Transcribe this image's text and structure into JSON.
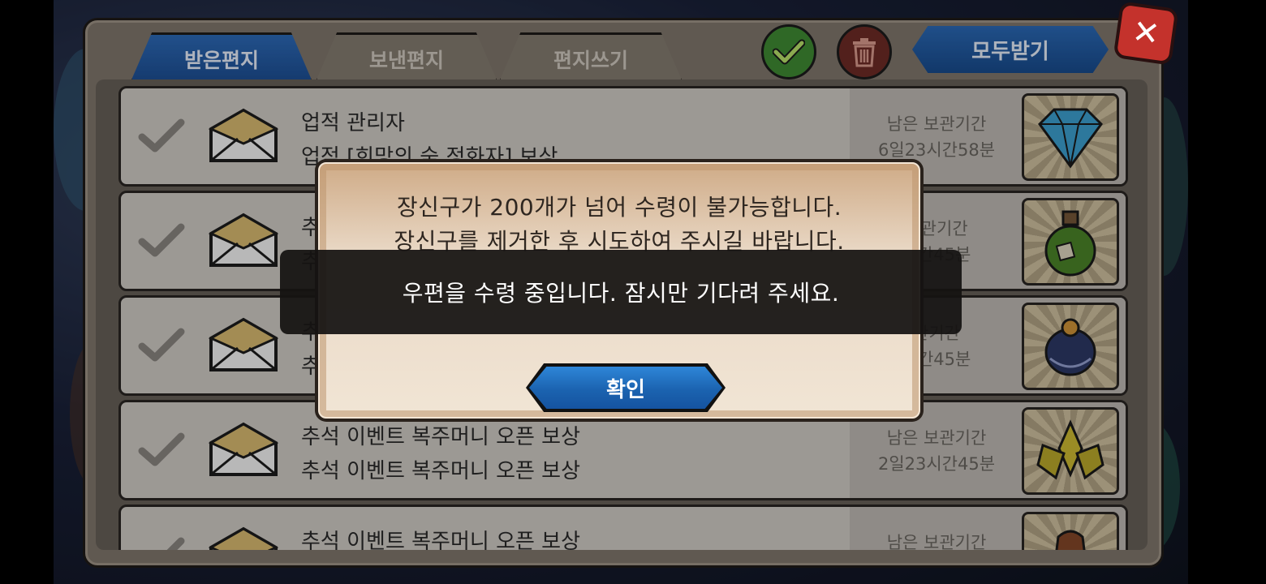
{
  "header": {
    "tabs": [
      {
        "label": "받은편지",
        "active": true
      },
      {
        "label": "보낸편지",
        "active": false
      },
      {
        "label": "편지쓰기",
        "active": false
      }
    ],
    "select_all_icon": "check-icon",
    "delete_icon": "trash-icon",
    "receive_all_label": "모두받기",
    "close_icon": "close-icon"
  },
  "mail_list": {
    "items": [
      {
        "sender": "업적 관리자",
        "subject": "업적 [희망의 숲 정화자] 보상",
        "expire_label": "남은 보관기간",
        "expire_time": "6일23시간58분",
        "reward_icon": "diamond-icon"
      },
      {
        "sender": "추",
        "subject": "추",
        "expire_label": "보관기간",
        "expire_time": "시간45분",
        "reward_icon": "potion-icon"
      },
      {
        "sender": "추",
        "subject": "추",
        "expire_label": "관기간",
        "expire_time": "시간45분",
        "reward_icon": "pet-egg-icon"
      },
      {
        "sender": "추석 이벤트 복주머니 오픈 보상",
        "subject": "추석 이벤트 복주머니 오픈 보상",
        "expire_label": "남은 보관기간",
        "expire_time": "2일23시간45분",
        "reward_icon": "crystal-icon"
      },
      {
        "sender": "추석 이벤트 복주머니 오픈 보상",
        "subject": "",
        "expire_label": "남은 보관기간",
        "expire_time": "",
        "reward_icon": "pouch-icon"
      }
    ]
  },
  "dialog": {
    "message_line1": "장신구가 200개가 넘어 수령이 불가능합니다.",
    "message_line2": "장신구를 제거한 후 시도하여 주시길 바랍니다.",
    "confirm_label": "확인"
  },
  "toast": {
    "message": "우편을 수령 중입니다. 잠시만 기다려 주세요."
  },
  "colors": {
    "tab_active": "#2c6ab8",
    "confirm_button": "#1b63b0",
    "close_button": "#c4322c",
    "check_button": "#3e8a33",
    "trash_button": "#6e2b25"
  }
}
